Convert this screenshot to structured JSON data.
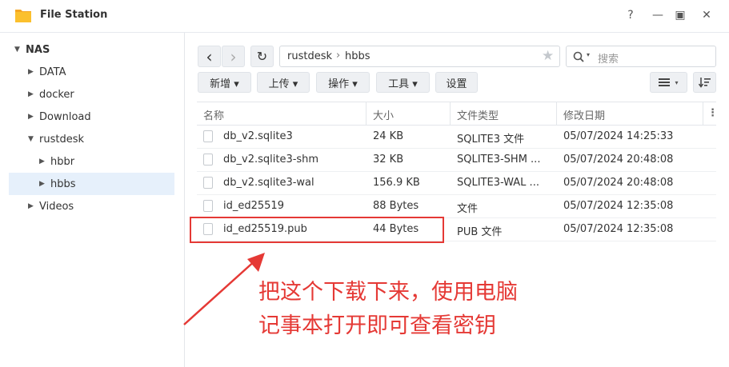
{
  "window": {
    "title": "File Station",
    "help": "?",
    "minimize": "—",
    "maximize": "▣",
    "close": "✕"
  },
  "sidebar": {
    "root": "NAS",
    "items": [
      "DATA",
      "docker",
      "Download",
      "rustdesk",
      "hbbr",
      "hbbs",
      "Videos"
    ]
  },
  "nav": {
    "back": "‹",
    "forward": "›",
    "refresh": "↻",
    "star": "★"
  },
  "breadcrumb": {
    "part1": "rustdesk",
    "sep": "›",
    "part2": "hbbs"
  },
  "search": {
    "placeholder": "搜索"
  },
  "toolbar": {
    "new": "新增 ▾",
    "upload": "上传 ▾",
    "action": "操作 ▾",
    "tools": "工具 ▾",
    "settings": "设置"
  },
  "columns": {
    "name": "名称",
    "size": "大小",
    "type": "文件类型",
    "modified": "修改日期",
    "more": "⋮"
  },
  "rows": [
    {
      "name": "db_v2.sqlite3",
      "size": "24 KB",
      "type": "SQLITE3 文件",
      "modified": "05/07/2024 14:25:33"
    },
    {
      "name": "db_v2.sqlite3-shm",
      "size": "32 KB",
      "type": "SQLITE3-SHM ...",
      "modified": "05/07/2024 20:48:08"
    },
    {
      "name": "db_v2.sqlite3-wal",
      "size": "156.9 KB",
      "type": "SQLITE3-WAL ...",
      "modified": "05/07/2024 20:48:08"
    },
    {
      "name": "id_ed25519",
      "size": "88 Bytes",
      "type": "文件",
      "modified": "05/07/2024 12:35:08"
    },
    {
      "name": "id_ed25519.pub",
      "size": "44 Bytes",
      "type": "PUB 文件",
      "modified": "05/07/2024 12:35:08"
    }
  ],
  "annotation": {
    "line1": "把这个下载下来，使用电脑",
    "line2": "记事本打开即可查看密钥"
  },
  "colors": {
    "accent": "#e53935",
    "selected": "#e6f0fb"
  }
}
